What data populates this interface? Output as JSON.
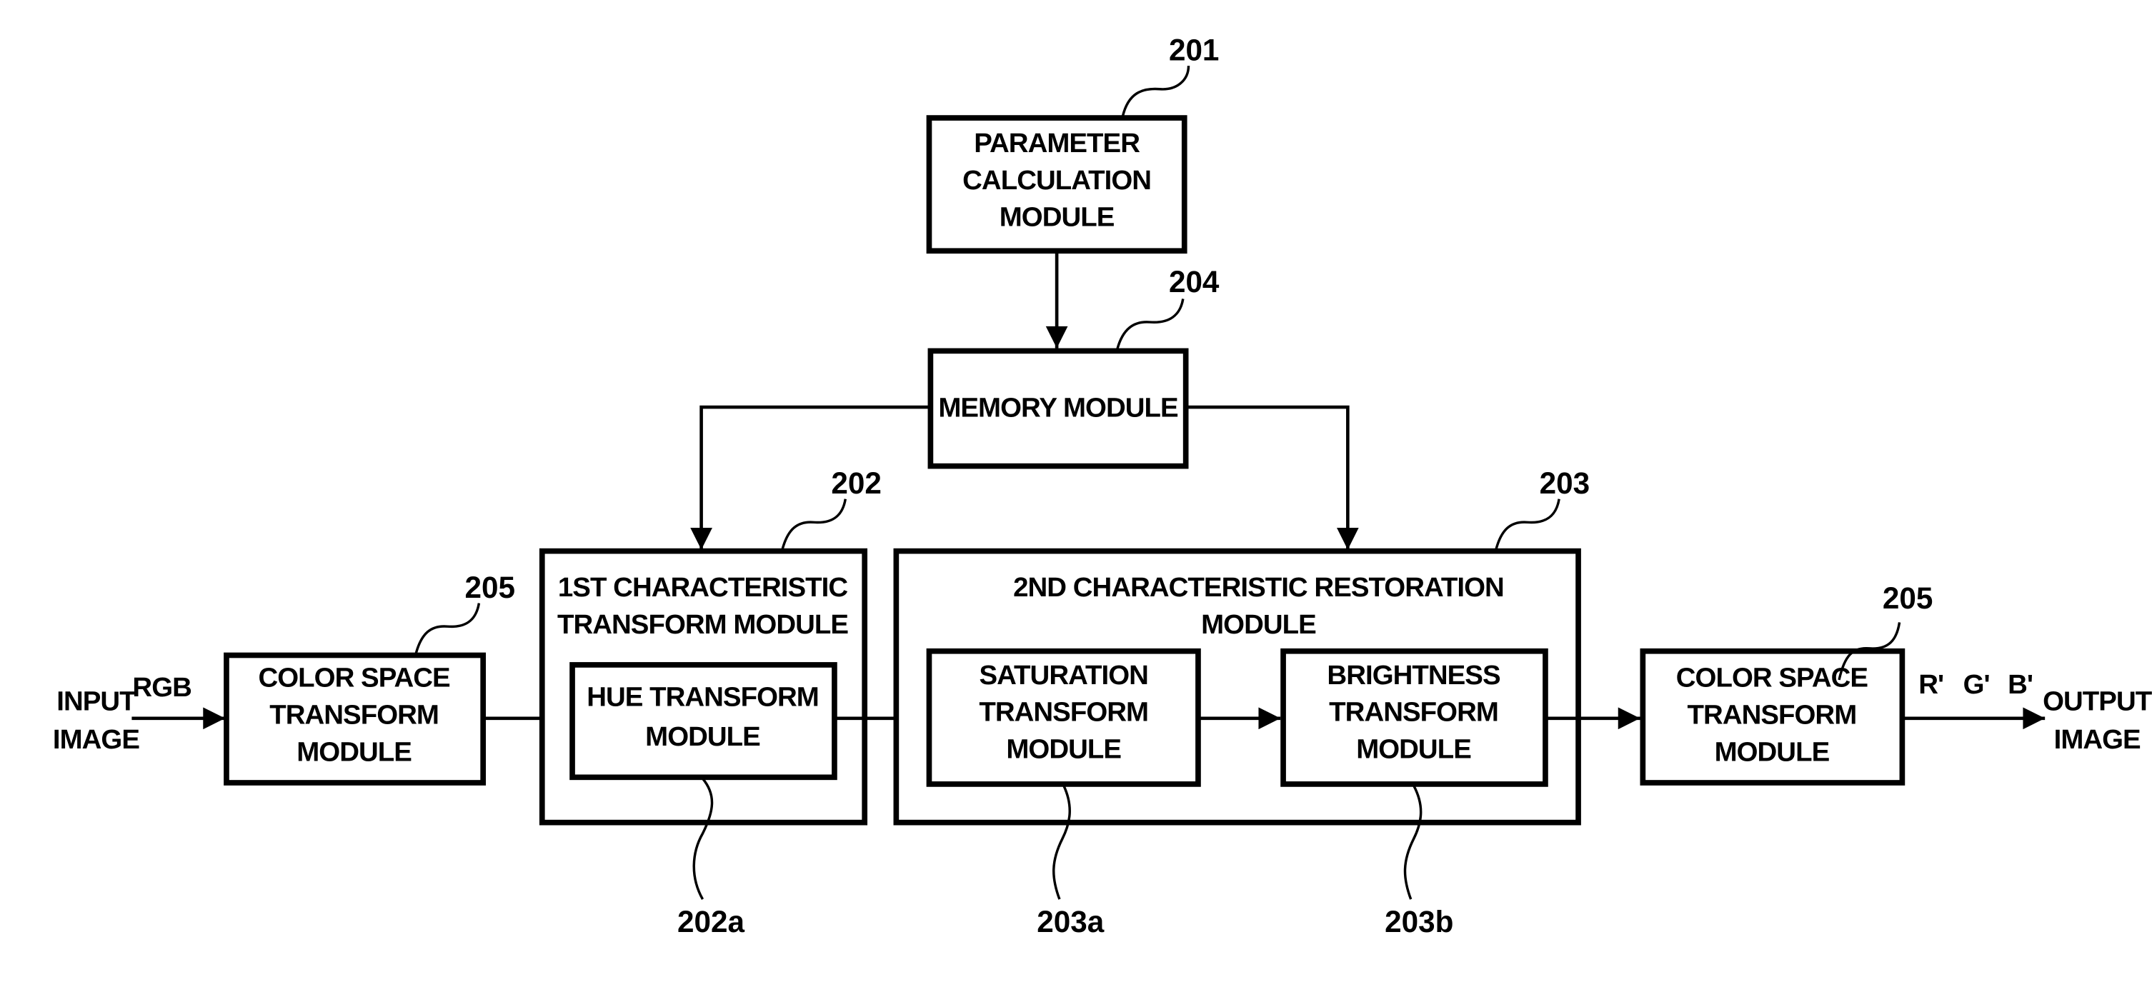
{
  "diagram": {
    "input": {
      "line1": "INPUT",
      "line2": "IMAGE",
      "signal": "RGB"
    },
    "output": {
      "line1": "OUTPUT",
      "line2": "IMAGE",
      "signal_r": "R'",
      "signal_g": "G'",
      "signal_b": "B'"
    },
    "param_module": {
      "line1": "PARAMETER",
      "line2": "CALCULATION",
      "line3": "MODULE",
      "ref": "201"
    },
    "memory_module": {
      "label": "MEMORY MODULE",
      "ref": "204"
    },
    "color_space_in": {
      "line1": "COLOR SPACE",
      "line2": "TRANSFORM",
      "line3": "MODULE",
      "ref": "205"
    },
    "first_char": {
      "line1": "1ST CHARACTERISTIC",
      "line2": "TRANSFORM MODULE",
      "ref": "202"
    },
    "hue": {
      "line1": "HUE TRANSFORM",
      "line2": "MODULE",
      "ref": "202a"
    },
    "second_char": {
      "line1": "2ND CHARACTERISTIC RESTORATION",
      "line2": "MODULE",
      "ref": "203"
    },
    "saturation": {
      "line1": "SATURATION",
      "line2": "TRANSFORM",
      "line3": "MODULE",
      "ref": "203a"
    },
    "brightness": {
      "line1": "BRIGHTNESS",
      "line2": "TRANSFORM",
      "line3": "MODULE",
      "ref": "203b"
    },
    "color_space_out": {
      "line1": "COLOR SPACE",
      "line2": "TRANSFORM",
      "line3": "MODULE",
      "ref": "205"
    }
  }
}
